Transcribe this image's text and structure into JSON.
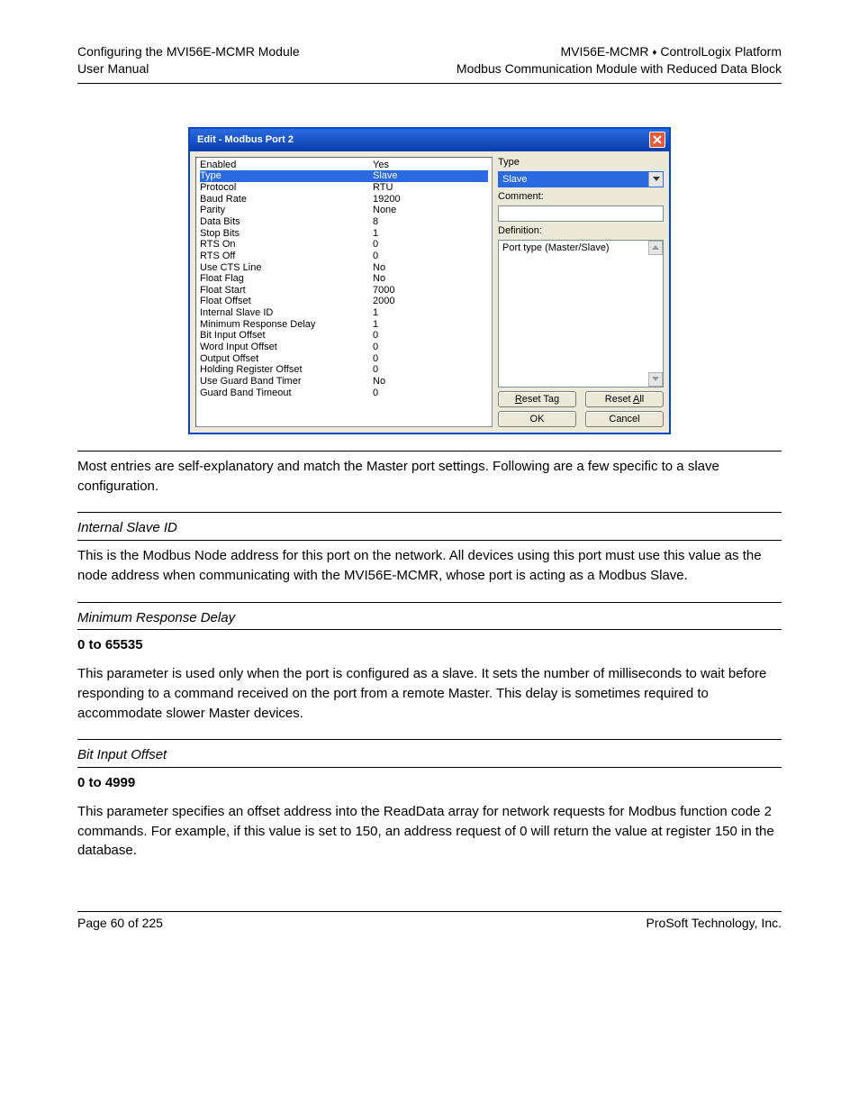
{
  "header": {
    "left_line1": "Configuring the MVI56E-MCMR Module",
    "left_line2": "User Manual",
    "right_line1_a": "MVI56E-MCMR ",
    "right_line1_b": " ControlLogix Platform",
    "right_line2": "Modbus Communication Module with Reduced Data Block"
  },
  "dialog": {
    "title": "Edit - Modbus Port 2",
    "params": [
      {
        "name": "Enabled",
        "value": "Yes",
        "sel": false
      },
      {
        "name": "Type",
        "value": "Slave",
        "sel": true
      },
      {
        "name": "Protocol",
        "value": "RTU",
        "sel": false
      },
      {
        "name": "Baud Rate",
        "value": "19200",
        "sel": false
      },
      {
        "name": "Parity",
        "value": "None",
        "sel": false
      },
      {
        "name": "Data Bits",
        "value": "8",
        "sel": false
      },
      {
        "name": "Stop Bits",
        "value": "1",
        "sel": false
      },
      {
        "name": "RTS On",
        "value": "0",
        "sel": false
      },
      {
        "name": "RTS Off",
        "value": "0",
        "sel": false
      },
      {
        "name": "Use CTS Line",
        "value": "No",
        "sel": false
      },
      {
        "name": "Float Flag",
        "value": "No",
        "sel": false
      },
      {
        "name": "Float Start",
        "value": "7000",
        "sel": false
      },
      {
        "name": "Float Offset",
        "value": "2000",
        "sel": false
      },
      {
        "name": "Internal Slave ID",
        "value": "1",
        "sel": false
      },
      {
        "name": "Minimum Response Delay",
        "value": "1",
        "sel": false
      },
      {
        "name": "Bit Input Offset",
        "value": "0",
        "sel": false
      },
      {
        "name": "Word Input Offset",
        "value": "0",
        "sel": false
      },
      {
        "name": "Output Offset",
        "value": "0",
        "sel": false
      },
      {
        "name": "Holding Register Offset",
        "value": "0",
        "sel": false
      },
      {
        "name": "Use Guard Band Timer",
        "value": "No",
        "sel": false
      },
      {
        "name": "Guard Band Timeout",
        "value": "0",
        "sel": false
      }
    ],
    "type_label": "Type",
    "type_value": "Slave",
    "comment_label": "Comment:",
    "comment_value": "",
    "definition_label": "Definition:",
    "definition_text": "Port type (Master/Slave)",
    "btn_reset_tag": "Reset Tag",
    "btn_reset_all": "Reset All",
    "btn_ok": "OK",
    "btn_cancel": "Cancel"
  },
  "sections": {
    "s1": {
      "p": "Most entries are self-explanatory and match the Master port settings. Following are a few specific to a slave configuration."
    },
    "s2": {
      "head": "Internal Slave ID",
      "p": "This is the Modbus Node address for this port on the network. All devices using this port must use this value as the node address when communicating with the MVI56E-MCMR, whose port is acting as a Modbus Slave."
    },
    "s3": {
      "head": "Minimum Response Delay",
      "range": "0 to 65535",
      "p": "This parameter is used only when the port is configured as a slave. It sets the number of milliseconds to wait before responding to a command received on the port from a remote Master. This delay is sometimes required to accommodate slower Master devices."
    },
    "s4": {
      "head": "Bit Input Offset",
      "range": "0 to 4999",
      "p": "This parameter specifies an offset address into the ReadData array for network requests for Modbus function code 2 commands. For example, if this value is set to 150, an address request of 0 will return the value at register 150 in the database."
    }
  },
  "footer": {
    "left": "Page 60 of 225",
    "right": "ProSoft Technology, Inc."
  }
}
